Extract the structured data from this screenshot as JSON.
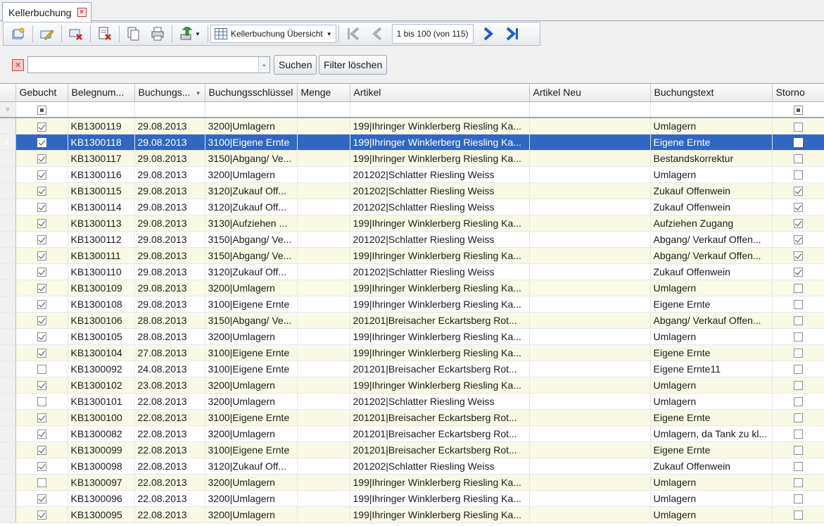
{
  "tab": {
    "title": "Kellerbuchung"
  },
  "toolbar": {
    "view_label": "Kellerbuchung Übersicht",
    "pager_label": "1 bis 100 (von 115)"
  },
  "filter": {
    "search_value": "",
    "search_button": "Suchen",
    "clear_button": "Filter löschen"
  },
  "grid": {
    "columns": [
      "Gebucht",
      "Belegnum...",
      "Buchungs...",
      "Buchungsschlüssel",
      "Menge",
      "Artikel",
      "Artikel Neu",
      "Buchungstext",
      "Storno"
    ],
    "rows": [
      {
        "gebucht": true,
        "beleg": "KB1300119",
        "datum": "29.08.2013",
        "schluessel": "3200|Umlagern",
        "menge": "",
        "artikel": "199|Ihringer Winklerberg Riesling Ka...",
        "artikel_neu": "",
        "text": "Umlagern",
        "storno": false
      },
      {
        "gebucht": true,
        "beleg": "KB1300118",
        "datum": "29.08.2013",
        "schluessel": "3100|Eigene Ernte",
        "menge": "",
        "artikel": "199|Ihringer Winklerberg Riesling Ka...",
        "artikel_neu": "",
        "text": "Eigene Ernte",
        "storno": false,
        "selected": true
      },
      {
        "gebucht": true,
        "beleg": "KB1300117",
        "datum": "29.08.2013",
        "schluessel": "3150|Abgang/ Ve...",
        "menge": "",
        "artikel": "199|Ihringer Winklerberg Riesling Ka...",
        "artikel_neu": "",
        "text": "Bestandskorrektur",
        "storno": false
      },
      {
        "gebucht": true,
        "beleg": "KB1300116",
        "datum": "29.08.2013",
        "schluessel": "3200|Umlagern",
        "menge": "",
        "artikel": "201202|Schlatter Riesling Weiss",
        "artikel_neu": "",
        "text": "Umlagern",
        "storno": false
      },
      {
        "gebucht": true,
        "beleg": "KB1300115",
        "datum": "29.08.2013",
        "schluessel": "3120|Zukauf Off...",
        "menge": "",
        "artikel": "201202|Schlatter Riesling Weiss",
        "artikel_neu": "",
        "text": "Zukauf Offenwein",
        "storno": true
      },
      {
        "gebucht": true,
        "beleg": "KB1300114",
        "datum": "29.08.2013",
        "schluessel": "3120|Zukauf Off...",
        "menge": "",
        "artikel": "201202|Schlatter Riesling Weiss",
        "artikel_neu": "",
        "text": "Zukauf Offenwein",
        "storno": true
      },
      {
        "gebucht": true,
        "beleg": "KB1300113",
        "datum": "29.08.2013",
        "schluessel": "3130|Aufziehen ...",
        "menge": "",
        "artikel": "199|Ihringer Winklerberg Riesling Ka...",
        "artikel_neu": "",
        "text": "Aufziehen Zugang",
        "storno": true
      },
      {
        "gebucht": true,
        "beleg": "KB1300112",
        "datum": "29.08.2013",
        "schluessel": "3150|Abgang/ Ve...",
        "menge": "",
        "artikel": "201202|Schlatter Riesling Weiss",
        "artikel_neu": "",
        "text": "Abgang/ Verkauf Offen...",
        "storno": true
      },
      {
        "gebucht": true,
        "beleg": "KB1300111",
        "datum": "29.08.2013",
        "schluessel": "3150|Abgang/ Ve...",
        "menge": "",
        "artikel": "199|Ihringer Winklerberg Riesling Ka...",
        "artikel_neu": "",
        "text": "Abgang/ Verkauf Offen...",
        "storno": true
      },
      {
        "gebucht": true,
        "beleg": "KB1300110",
        "datum": "29.08.2013",
        "schluessel": "3120|Zukauf Off...",
        "menge": "",
        "artikel": "201202|Schlatter Riesling Weiss",
        "artikel_neu": "",
        "text": "Zukauf Offenwein",
        "storno": true
      },
      {
        "gebucht": true,
        "beleg": "KB1300109",
        "datum": "29.08.2013",
        "schluessel": "3200|Umlagern",
        "menge": "",
        "artikel": "199|Ihringer Winklerberg Riesling Ka...",
        "artikel_neu": "",
        "text": "Umlagern",
        "storno": false
      },
      {
        "gebucht": true,
        "beleg": "KB1300108",
        "datum": "29.08.2013",
        "schluessel": "3100|Eigene Ernte",
        "menge": "",
        "artikel": "199|Ihringer Winklerberg Riesling Ka...",
        "artikel_neu": "",
        "text": "Eigene Ernte",
        "storno": false
      },
      {
        "gebucht": true,
        "beleg": "KB1300106",
        "datum": "28.08.2013",
        "schluessel": "3150|Abgang/ Ve...",
        "menge": "",
        "artikel": "201201|Breisacher Eckartsberg Rot...",
        "artikel_neu": "",
        "text": "Abgang/ Verkauf Offen...",
        "storno": false
      },
      {
        "gebucht": true,
        "beleg": "KB1300105",
        "datum": "28.08.2013",
        "schluessel": "3200|Umlagern",
        "menge": "",
        "artikel": "199|Ihringer Winklerberg Riesling Ka...",
        "artikel_neu": "",
        "text": "Umlagern",
        "storno": false
      },
      {
        "gebucht": true,
        "beleg": "KB1300104",
        "datum": "27.08.2013",
        "schluessel": "3100|Eigene Ernte",
        "menge": "",
        "artikel": "199|Ihringer Winklerberg Riesling Ka...",
        "artikel_neu": "",
        "text": "Eigene Ernte",
        "storno": false
      },
      {
        "gebucht": false,
        "beleg": "KB1300092",
        "datum": "24.08.2013",
        "schluessel": "3100|Eigene Ernte",
        "menge": "",
        "artikel": "201201|Breisacher Eckartsberg Rot...",
        "artikel_neu": "",
        "text": "Eigene Ernte11",
        "storno": false
      },
      {
        "gebucht": true,
        "beleg": "KB1300102",
        "datum": "23.08.2013",
        "schluessel": "3200|Umlagern",
        "menge": "",
        "artikel": "199|Ihringer Winklerberg Riesling Ka...",
        "artikel_neu": "",
        "text": "Umlagern",
        "storno": false
      },
      {
        "gebucht": false,
        "beleg": "KB1300101",
        "datum": "22.08.2013",
        "schluessel": "3200|Umlagern",
        "menge": "",
        "artikel": "201202|Schlatter Riesling Weiss",
        "artikel_neu": "",
        "text": "Umlagern",
        "storno": false
      },
      {
        "gebucht": true,
        "beleg": "KB1300100",
        "datum": "22.08.2013",
        "schluessel": "3100|Eigene Ernte",
        "menge": "",
        "artikel": "201201|Breisacher Eckartsberg Rot...",
        "artikel_neu": "",
        "text": "Eigene Ernte",
        "storno": false
      },
      {
        "gebucht": true,
        "beleg": "KB1300082",
        "datum": "22.08.2013",
        "schluessel": "3200|Umlagern",
        "menge": "",
        "artikel": "201201|Breisacher Eckartsberg Rot...",
        "artikel_neu": "",
        "text": "Umlagern, da Tank zu kl...",
        "storno": false
      },
      {
        "gebucht": true,
        "beleg": "KB1300099",
        "datum": "22.08.2013",
        "schluessel": "3100|Eigene Ernte",
        "menge": "",
        "artikel": "201201|Breisacher Eckartsberg Rot...",
        "artikel_neu": "",
        "text": "Eigene Ernte",
        "storno": false
      },
      {
        "gebucht": true,
        "beleg": "KB1300098",
        "datum": "22.08.2013",
        "schluessel": "3120|Zukauf Off...",
        "menge": "",
        "artikel": "201202|Schlatter Riesling Weiss",
        "artikel_neu": "",
        "text": "Zukauf Offenwein",
        "storno": false
      },
      {
        "gebucht": false,
        "beleg": "KB1300097",
        "datum": "22.08.2013",
        "schluessel": "3200|Umlagern",
        "menge": "",
        "artikel": "199|Ihringer Winklerberg Riesling Ka...",
        "artikel_neu": "",
        "text": "Umlagern",
        "storno": false
      },
      {
        "gebucht": true,
        "beleg": "KB1300096",
        "datum": "22.08.2013",
        "schluessel": "3200|Umlagern",
        "menge": "",
        "artikel": "199|Ihringer Winklerberg Riesling Ka...",
        "artikel_neu": "",
        "text": "Umlagern",
        "storno": false
      },
      {
        "gebucht": true,
        "beleg": "KB1300095",
        "datum": "22.08.2013",
        "schluessel": "3200|Umlagern",
        "menge": "",
        "artikel": "199|Ihringer Winklerberg Riesling Ka...",
        "artikel_neu": "",
        "text": "Umlagern",
        "storno": false
      }
    ]
  },
  "colors": {
    "selection": "#3167c1",
    "alt_row": "#fafae4",
    "accent_icon": "#1f5fbf"
  }
}
